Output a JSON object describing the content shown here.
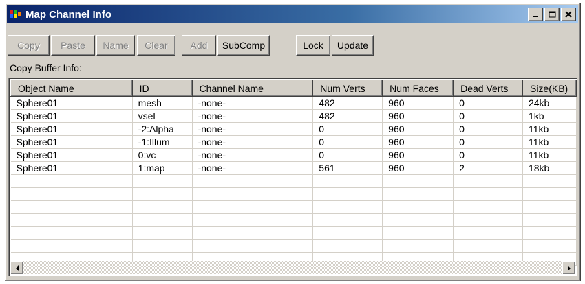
{
  "window": {
    "title": "Map Channel Info",
    "controls": {
      "minimize": "_",
      "maximize": "□",
      "close": "✕"
    }
  },
  "toolbar": {
    "buttons": [
      {
        "label": "Copy",
        "enabled": false
      },
      {
        "label": "Paste",
        "enabled": false
      },
      {
        "label": "Name",
        "enabled": false
      },
      {
        "label": "Clear",
        "enabled": false
      },
      {
        "label": "Add",
        "enabled": false
      },
      {
        "label": "SubComp",
        "enabled": true
      },
      {
        "label": "Lock",
        "enabled": true
      },
      {
        "label": "Update",
        "enabled": true
      }
    ]
  },
  "buffer_label": "Copy Buffer Info:",
  "table": {
    "columns": [
      "Object Name",
      "ID",
      "Channel Name",
      "Num Verts",
      "Num Faces",
      "Dead Verts",
      "Size(KB)"
    ],
    "rows": [
      [
        "Sphere01",
        "mesh",
        "-none-",
        "482",
        "960",
        "0",
        "24kb"
      ],
      [
        "Sphere01",
        "vsel",
        "-none-",
        "482",
        "960",
        "0",
        "1kb"
      ],
      [
        "Sphere01",
        "-2:Alpha",
        "-none-",
        "0",
        "960",
        "0",
        "11kb"
      ],
      [
        "Sphere01",
        "-1:Illum",
        "-none-",
        "0",
        "960",
        "0",
        "11kb"
      ],
      [
        "Sphere01",
        "0:vc",
        "-none-",
        "0",
        "960",
        "0",
        "11kb"
      ],
      [
        "Sphere01",
        "1:map",
        "-none-",
        "561",
        "960",
        "2",
        "18kb"
      ]
    ],
    "empty_rows": 7
  }
}
